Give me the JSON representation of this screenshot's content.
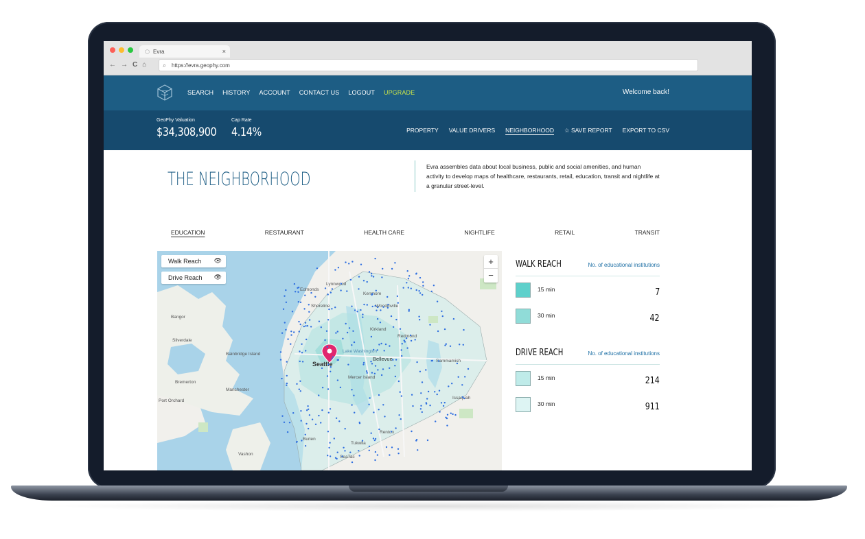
{
  "browser": {
    "tab_title": "Evra",
    "tab_close": "×",
    "url": "https://evra.geophy.com",
    "nav": {
      "back": "←",
      "forward": "→",
      "reload": "C",
      "home": "⌂"
    }
  },
  "header": {
    "menu": [
      "SEARCH",
      "HISTORY",
      "ACCOUNT",
      "CONTACT US",
      "LOGOUT"
    ],
    "upgrade": "UPGRADE",
    "welcome": "Welcome back!"
  },
  "subheader": {
    "valuation_label": "GeoPhy Valuation",
    "valuation_value": "$34,308,900",
    "cap_rate_label": "Cap Rate",
    "cap_rate_value": "4.14%",
    "tabs": [
      "PROPERTY",
      "VALUE DRIVERS",
      "NEIGHBORHOOD"
    ],
    "save_report": "SAVE REPORT",
    "export_csv": "EXPORT TO CSV"
  },
  "section": {
    "title": "THE NEIGHBORHOOD",
    "description": "Evra assembles data about local business, public and social amenities, and human activity to develop maps of healthcare, restaurants, retail, education, transit and nightlife at a granular street-level."
  },
  "categories": [
    "EDUCATION",
    "RESTAURANT",
    "HEALTH CARE",
    "NIGHTLIFE",
    "RETAIL",
    "TRANSIT"
  ],
  "map": {
    "walk_reach_btn": "Walk Reach",
    "drive_reach_btn": "Drive Reach",
    "zoom_in": "+",
    "zoom_out": "−",
    "places": [
      "Edmonds",
      "Lynnwood",
      "Shoreline",
      "Woodinville",
      "Kirkland",
      "Redmond",
      "Bangor",
      "Silverdale",
      "Bainbridge Island",
      "Seattle",
      "Lake Washington",
      "Bellevue",
      "Sammamish",
      "Mercer Island",
      "Bremerton",
      "Manchester",
      "Port Orchard",
      "Issaquah",
      "Renton",
      "Burien",
      "Tukwila",
      "Vashon",
      "SeaTac",
      "Kenmore"
    ]
  },
  "walk_reach": {
    "title": "WALK REACH",
    "subtitle": "No. of educational institutions",
    "rows": [
      {
        "label": "15 min",
        "value": "7",
        "color": "#5ed0cb"
      },
      {
        "label": "30 min",
        "value": "42",
        "color": "#90dcd8"
      }
    ]
  },
  "drive_reach": {
    "title": "DRIVE REACH",
    "subtitle": "No. of educational institutions",
    "rows": [
      {
        "label": "15 min",
        "value": "214",
        "color": "#bfebe9"
      },
      {
        "label": "30 min",
        "value": "911",
        "color": "#ddf4f3"
      }
    ]
  }
}
